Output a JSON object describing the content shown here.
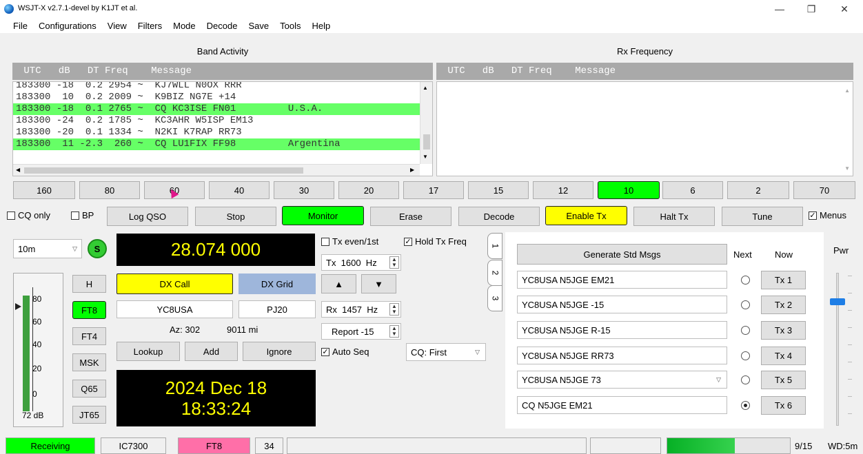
{
  "window": {
    "title": "WSJT-X  v2.7.1-devel   by K1JT et al.",
    "minimize_glyph": "—",
    "restore_glyph": "❐",
    "close_glyph": "✕"
  },
  "menu": [
    "File",
    "Configurations",
    "View",
    "Filters",
    "Mode",
    "Decode",
    "Save",
    "Tools",
    "Help"
  ],
  "band_activity": {
    "title": "Band Activity",
    "header": " UTC   dB   DT Freq    Message",
    "rows": [
      {
        "text": "183300 -18  0.2 2954 ~  KJ7WLL N0OX RRR",
        "cq": false
      },
      {
        "text": "183300  10  0.2 2009 ~  K9BIZ NG7E +14",
        "cq": false
      },
      {
        "text": "183300 -18  0.1 2765 ~  CQ KC3ISE FN01         U.S.A.",
        "cq": true
      },
      {
        "text": "183300 -24  0.2 1785 ~  KC3AHR W5ISP EM13",
        "cq": false
      },
      {
        "text": "183300 -20  0.1 1334 ~  N2KI K7RAP RR73",
        "cq": false
      },
      {
        "text": "183300  11 -2.3  260 ~  CQ LU1FIX FF98         Argentina",
        "cq": true
      }
    ]
  },
  "rx_frequency": {
    "title": "Rx Frequency",
    "header": " UTC   dB   DT Freq    Message"
  },
  "bands": [
    "160",
    "80",
    "60",
    "40",
    "30",
    "20",
    "17",
    "15",
    "12",
    "10",
    "6",
    "2",
    "70"
  ],
  "active_band": "10",
  "controls": {
    "cq_only": "CQ only",
    "bp": "BP",
    "log_qso": "Log QSO",
    "stop": "Stop",
    "monitor": "Monitor",
    "erase": "Erase",
    "decode": "Decode",
    "enable_tx": "Enable Tx",
    "halt_tx": "Halt Tx",
    "tune": "Tune",
    "menus": "Menus"
  },
  "left": {
    "band_select": "10m",
    "s_badge": "S",
    "frequency": "28.074 000",
    "db_level": "72 dB",
    "meter_ticks": [
      "80",
      "60",
      "40",
      "20",
      "0"
    ],
    "modes": [
      "H",
      "FT8",
      "FT4",
      "MSK",
      "Q65",
      "JT65"
    ],
    "active_mode": "FT8",
    "dx_call_label": "DX Call",
    "dx_grid_label": "DX Grid",
    "dx_call": "YC8USA",
    "dx_grid": "PJ20",
    "az": "Az: 302",
    "dist": "9011 mi",
    "lookup": "Lookup",
    "add": "Add",
    "ignore": "Ignore",
    "date": "2024 Dec 18",
    "time": "18:33:24"
  },
  "mid": {
    "tx_even": "Tx even/1st",
    "hold_tx_freq": "Hold Tx Freq",
    "tx_freq": "Tx  1600  Hz",
    "rx_freq": "Rx  1457  Hz",
    "report": "Report -15",
    "auto_seq": "Auto Seq",
    "cq_select": "CQ: First",
    "up_arrow": "▲",
    "down_arrow": "▼"
  },
  "tabs": [
    "1",
    "2",
    "3"
  ],
  "messages": {
    "generate": "Generate Std Msgs",
    "next_label": "Next",
    "now_label": "Now",
    "pwr_label": "Pwr",
    "rows": [
      {
        "msg": "YC8USA N5JGE EM21",
        "tx": "Tx 1",
        "selected": false
      },
      {
        "msg": "YC8USA N5JGE -15",
        "tx": "Tx 2",
        "selected": false
      },
      {
        "msg": "YC8USA N5JGE R-15",
        "tx": "Tx 3",
        "selected": false
      },
      {
        "msg": "YC8USA N5JGE RR73",
        "tx": "Tx 4",
        "selected": false
      },
      {
        "msg": "YC8USA N5JGE 73",
        "tx": "Tx 5",
        "selected": false
      },
      {
        "msg": "CQ N5JGE EM21",
        "tx": "Tx 6",
        "selected": true
      }
    ]
  },
  "status_bar": {
    "receiving": "Receiving",
    "rig": "IC7300",
    "mode": "FT8",
    "count": "34",
    "progress_fraction": 0.55,
    "period": "9/15",
    "wd": "WD:5m"
  },
  "colors": {
    "cq_green": "#66ff66",
    "button_green": "#00ff00",
    "button_yellow": "#ffff00",
    "mode_pink": "#ff6fa8",
    "lcd_yellow": "#ffff00"
  }
}
